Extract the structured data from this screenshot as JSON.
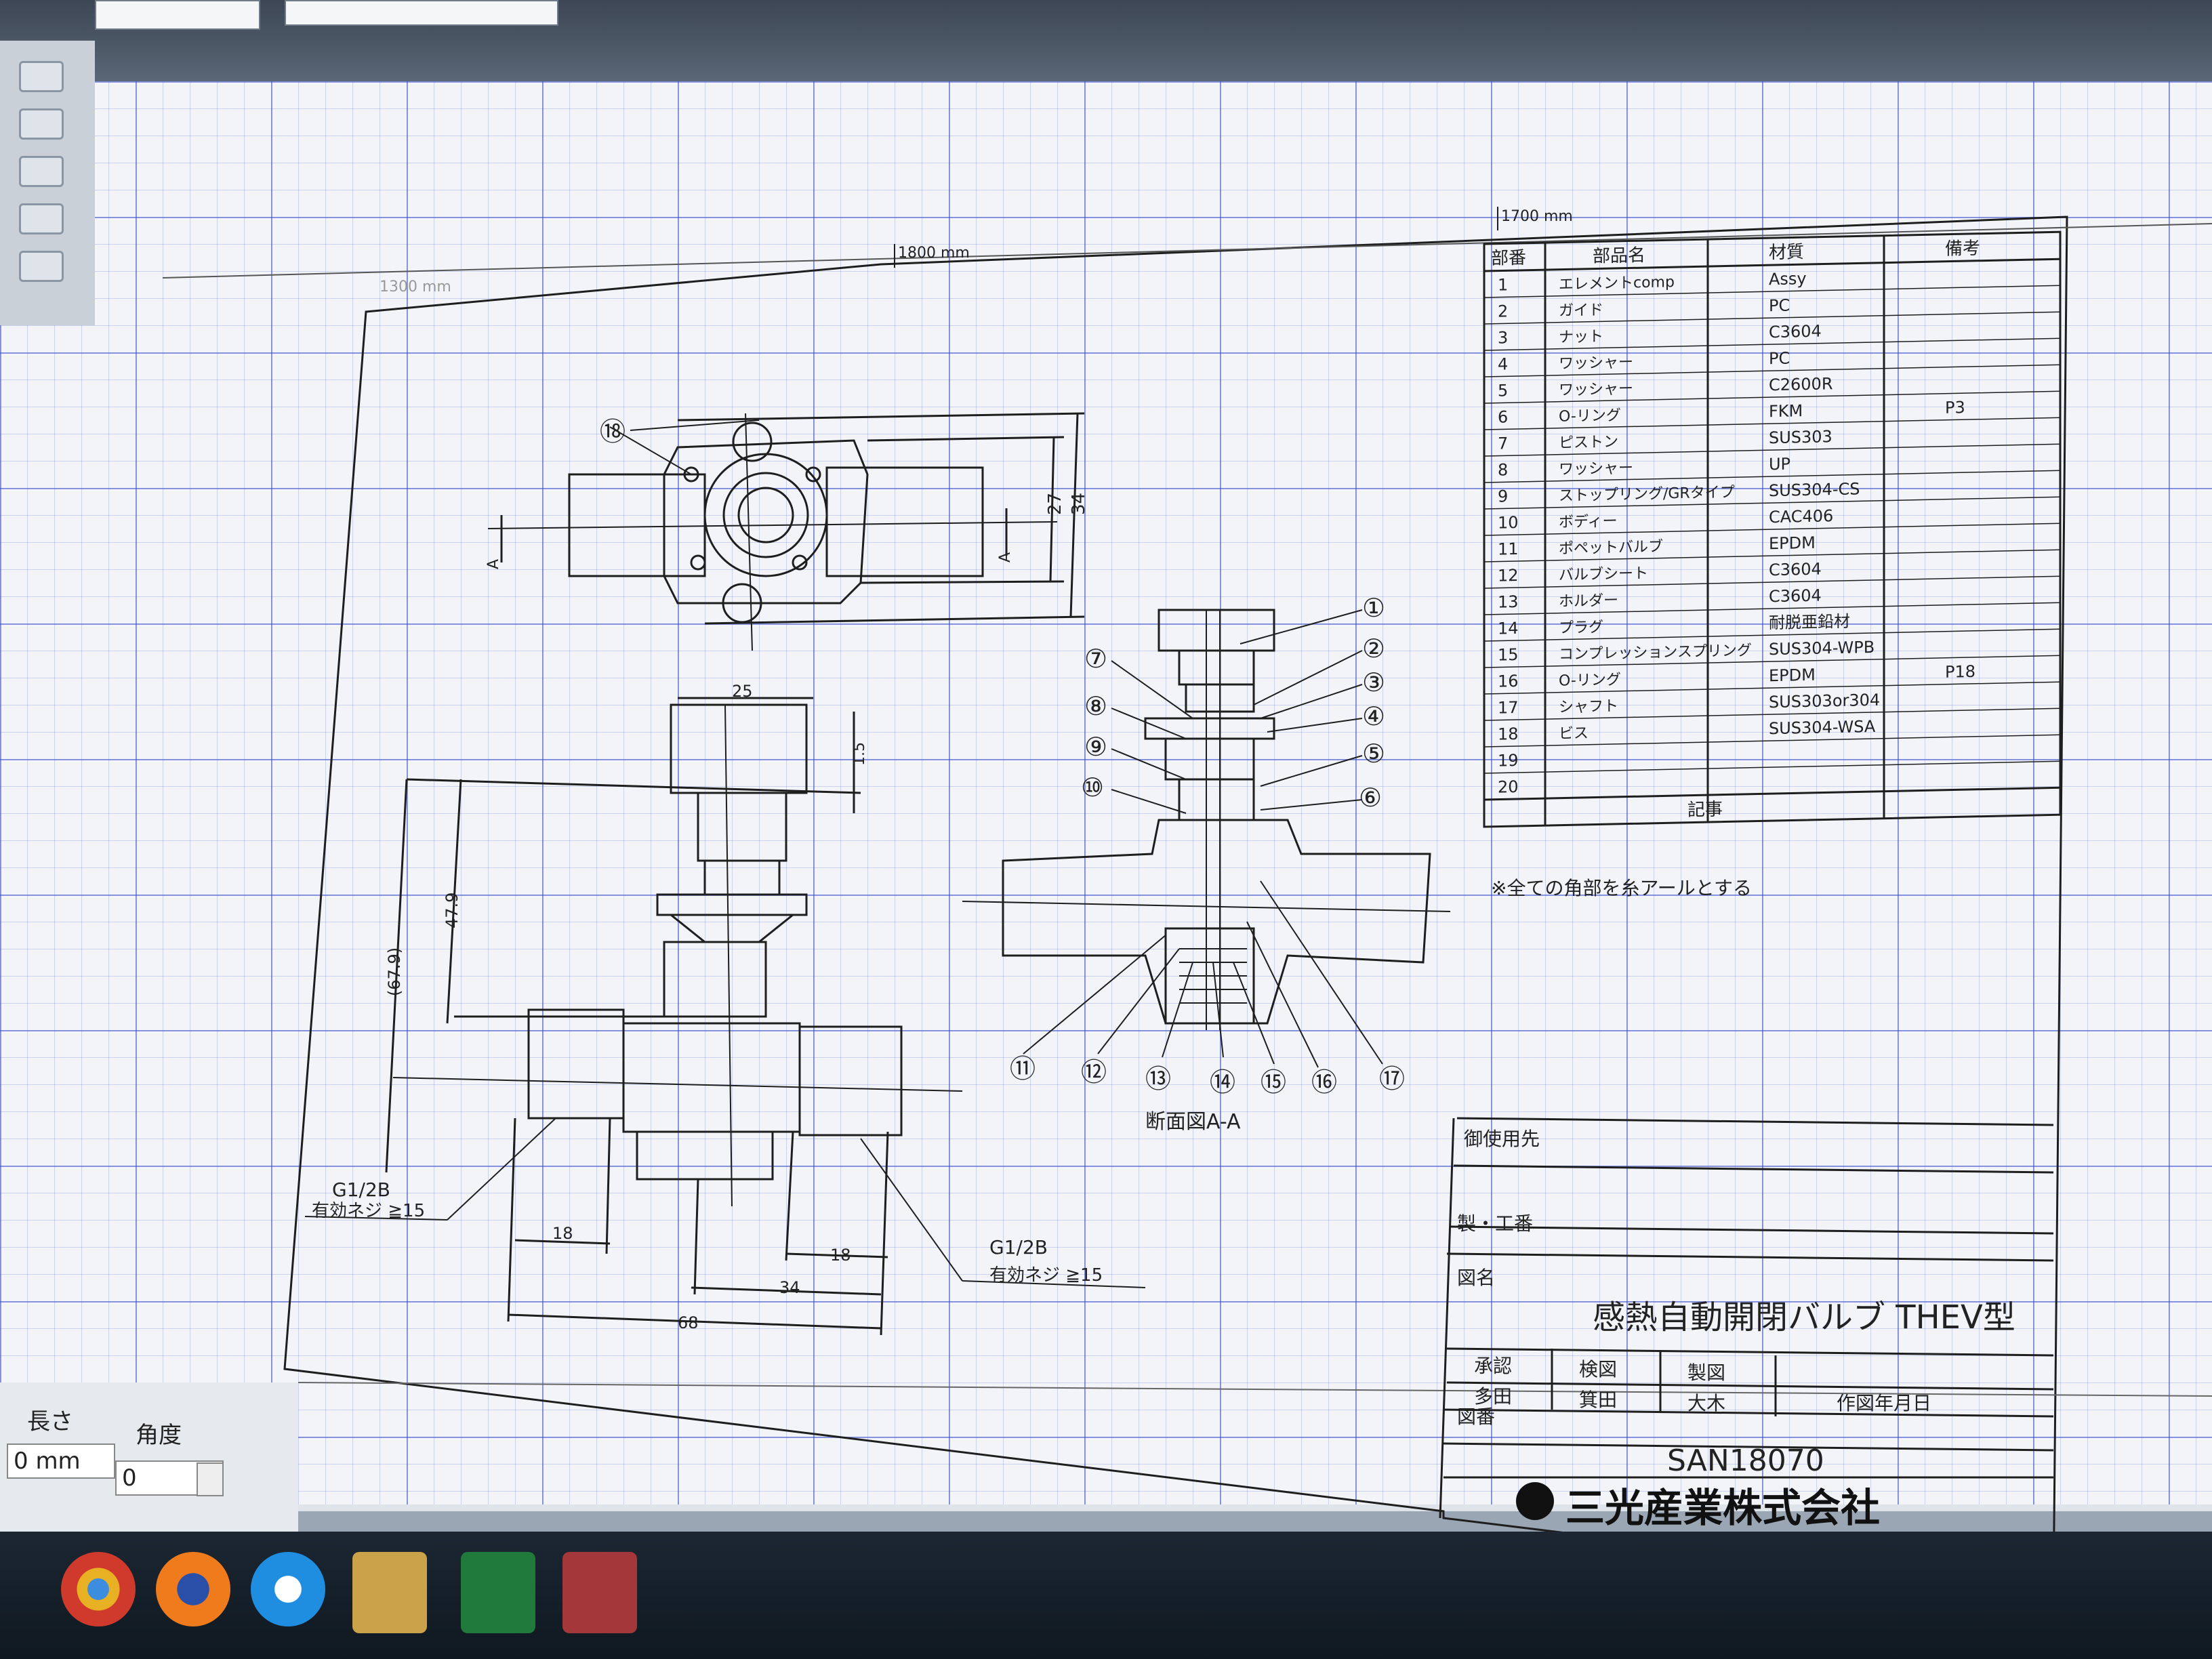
{
  "rulers": {
    "left": "1800 mm",
    "right": "1700 mm",
    "faded": "1300 mm"
  },
  "parts_table": {
    "headers": {
      "no": "部番",
      "name": "部品名",
      "material": "材質",
      "note": "備考"
    },
    "rows": [
      {
        "no": "1",
        "name": "エレメントcomp",
        "material": "Assy",
        "note": ""
      },
      {
        "no": "2",
        "name": "ガイド",
        "material": "PC",
        "note": ""
      },
      {
        "no": "3",
        "name": "ナット",
        "material": "C3604",
        "note": ""
      },
      {
        "no": "4",
        "name": "ワッシャー",
        "material": "PC",
        "note": ""
      },
      {
        "no": "5",
        "name": "ワッシャー",
        "material": "C2600R",
        "note": ""
      },
      {
        "no": "6",
        "name": "O-リング",
        "material": "FKM",
        "note": "P3"
      },
      {
        "no": "7",
        "name": "ピストン",
        "material": "SUS303",
        "note": ""
      },
      {
        "no": "8",
        "name": "ワッシャー",
        "material": "UP",
        "note": ""
      },
      {
        "no": "9",
        "name": "ストップリング/GRタイプ",
        "material": "SUS304-CS",
        "note": ""
      },
      {
        "no": "10",
        "name": "ボディー",
        "material": "CAC406",
        "note": ""
      },
      {
        "no": "11",
        "name": "ポペットバルブ",
        "material": "EPDM",
        "note": ""
      },
      {
        "no": "12",
        "name": "バルブシート",
        "material": "C3604",
        "note": ""
      },
      {
        "no": "13",
        "name": "ホルダー",
        "material": "C3604",
        "note": ""
      },
      {
        "no": "14",
        "name": "プラグ",
        "material": "耐脱亜鉛材",
        "note": ""
      },
      {
        "no": "15",
        "name": "コンプレッションスプリング",
        "material": "SUS304-WPB",
        "note": ""
      },
      {
        "no": "16",
        "name": "O-リング",
        "material": "EPDM",
        "note": "P18"
      },
      {
        "no": "17",
        "name": "シャフト",
        "material": "SUS303or304",
        "note": ""
      },
      {
        "no": "18",
        "name": "ビス",
        "material": "SUS304-WSA",
        "note": ""
      },
      {
        "no": "19",
        "name": "",
        "material": "",
        "note": ""
      },
      {
        "no": "20",
        "name": "",
        "material": "",
        "note": ""
      }
    ]
  },
  "notes": {
    "header": "記事",
    "text": "※全ての角部を糸アールとする"
  },
  "title_block": {
    "customer_label": "御使用先",
    "work_no_label": "製・工番",
    "drawing_name_label": "図名",
    "drawing_name": "感熱自動開閉バルブ THEV型",
    "approved_label": "承認",
    "approved_by": "多田",
    "checked_label": "検図",
    "checked_by": "箕田",
    "drawn_label": "製図",
    "drawn_by": "大木",
    "date_label": "作図年月日",
    "drawing_no_label": "図番",
    "drawing_no": "SAN18070",
    "company": "三光産業株式会社"
  },
  "drawing": {
    "section_title": "断面図A-A",
    "section_marker": "A",
    "balloons": [
      "①",
      "②",
      "③",
      "④",
      "⑤",
      "⑥",
      "⑦",
      "⑧",
      "⑨",
      "⑩",
      "⑪",
      "⑫",
      "⑬",
      "⑭",
      "⑮",
      "⑯",
      "⑰",
      "⑱"
    ],
    "dimensions": {
      "top_height": "34",
      "top_inner": "27",
      "stem_width": "25",
      "gap": "1.5",
      "height_total": "(67.9)",
      "height": "47.9",
      "port_left": "18",
      "port_right": "18",
      "half_width": "34",
      "total_width": "68"
    },
    "thread_left": {
      "line1": "G1/2B",
      "line2": "有効ネジ ≧15"
    },
    "thread_right": {
      "line1": "G1/2B",
      "line2": "有効ネジ ≧15"
    }
  },
  "properties": {
    "length_label": "長さ",
    "length_value": "0 mm",
    "angle_label": "角度",
    "angle_value": "0"
  },
  "taskbar": {
    "apps": [
      "chrome-icon",
      "firefox-icon",
      "ie-icon",
      "explorer-icon",
      "excel-icon",
      "access-icon"
    ]
  },
  "colors": {
    "grid": "#3c50c8",
    "line": "#202020",
    "paper": "#f2f4f8"
  }
}
